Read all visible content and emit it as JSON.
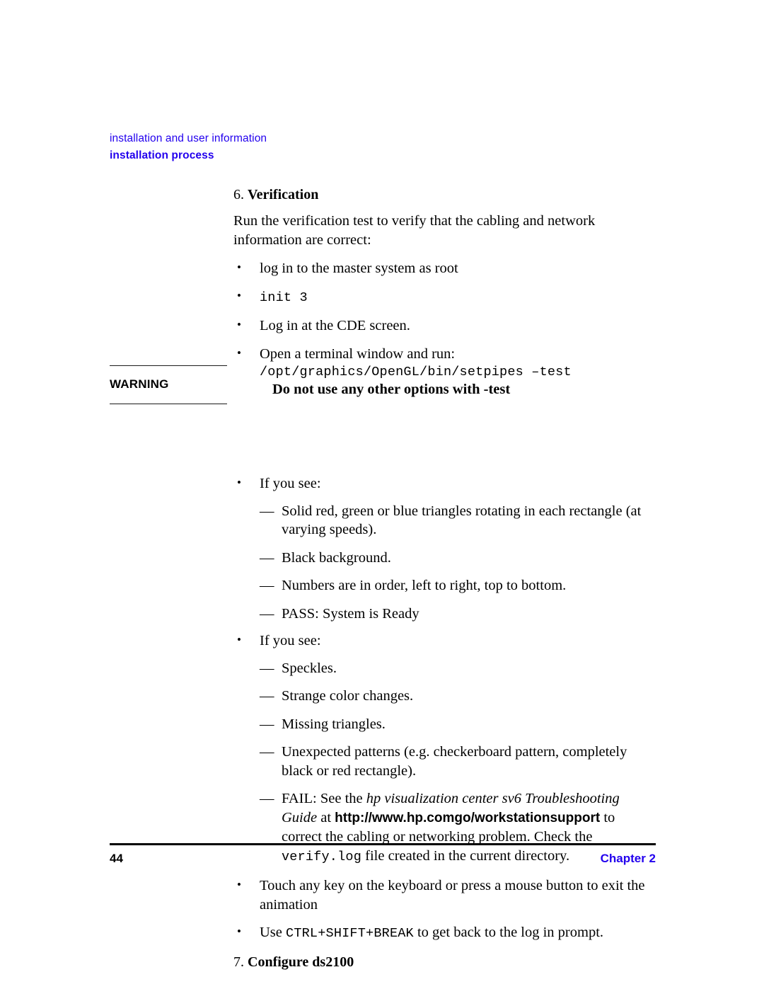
{
  "page": {
    "background_color": "#ffffff",
    "accent_blue": "#2200ee",
    "text_color": "#000000"
  },
  "running_header": {
    "line1": "installation and user information",
    "line2": "installation process"
  },
  "steps": {
    "step6": {
      "number": "6.",
      "title": "Verification"
    },
    "step7": {
      "number": "7.",
      "title": "Configure ds2100"
    }
  },
  "intro_paragraph": "Run the verification test to verify that the cabling and network information are correct:",
  "first_bullets": [
    {
      "text": "log in to the master system as root",
      "style": "serif"
    },
    {
      "text": "init 3",
      "style": "mono"
    },
    {
      "text": "Log in at the CDE screen.",
      "style": "serif"
    },
    {
      "text": "Open a terminal window and run:",
      "style": "serif",
      "code_line": "/opt/graphics/OpenGL/bin/setpipes –test"
    }
  ],
  "warning": {
    "label": "WARNING",
    "text": "Do not use any other options with -test"
  },
  "if_you_see_1": {
    "lead": "If you see:",
    "items": [
      "Solid red, green or blue triangles rotating in each rectangle (at varying speeds).",
      "Black background.",
      "Numbers are in order, left to right, top to bottom.",
      "PASS: System is Ready"
    ]
  },
  "if_you_see_2": {
    "lead": "If you see:",
    "items": [
      "Speckles.",
      "Strange color changes.",
      "Missing triangles.",
      "Unexpected patterns (e.g. checkerboard pattern, completely black or red rectangle)."
    ],
    "fail_item": {
      "part1": "FAIL: See the ",
      "italic1": "hp visualization center sv6 Troubleshooting Guide",
      "part2": " at ",
      "url": "http://www.hp.comgo/workstationsupport",
      "part3": " to correct the cabling or networking problem. Check the ",
      "code": "verify.log",
      "part4": " file created in the current directory."
    }
  },
  "closing_bullets": {
    "touch": "Touch any key on the keyboard or press a mouse button to exit the animation",
    "use_prefix": "Use ",
    "use_code": "CTRL+SHIFT+BREAK",
    "use_suffix": " to get back to the log in prompt."
  },
  "footer": {
    "page_number": "44",
    "chapter": "Chapter 2"
  }
}
